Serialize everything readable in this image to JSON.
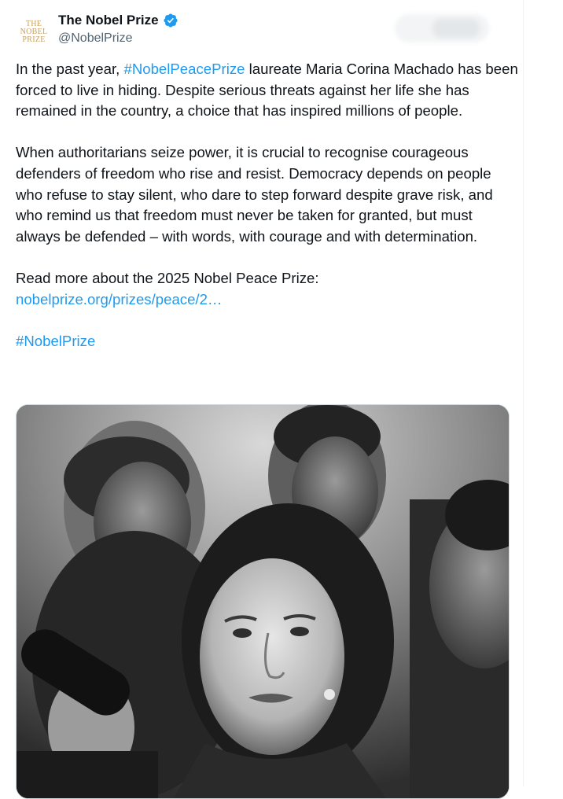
{
  "tweet": {
    "author": {
      "name": "The Nobel Prize",
      "handle": "@NobelPrize",
      "logo_lines": [
        "THE",
        "NOBEL",
        "PRIZE"
      ],
      "verified_icon": "verified-badge-icon"
    },
    "paragraph1": {
      "pre": "In the past year, ",
      "hashtag": "#NobelPeacePrize",
      "post": " laureate Maria Corina Machado has been forced to live in hiding. Despite serious threats against her life she has remained in the country, a choice that has inspired millions of people."
    },
    "paragraph2": "When authoritarians seize power, it is crucial to recognise courageous defenders of freedom who rise and resist. Democracy depends on people who refuse to stay silent, who dare to step forward despite grave risk, and who remind us that freedom must never be taken for granted, but must always be defended – with words, with courage and with determination.",
    "read_more": "Read more about the 2025 Nobel Peace Prize:",
    "link": "nobelprize.org/prizes/peace/2…",
    "closing_hashtag": "#NobelPrize"
  },
  "colors": {
    "accent": "#1d9bf0",
    "text": "#0f1419",
    "muted": "#536471",
    "logo_gold": "#c7a15a"
  }
}
